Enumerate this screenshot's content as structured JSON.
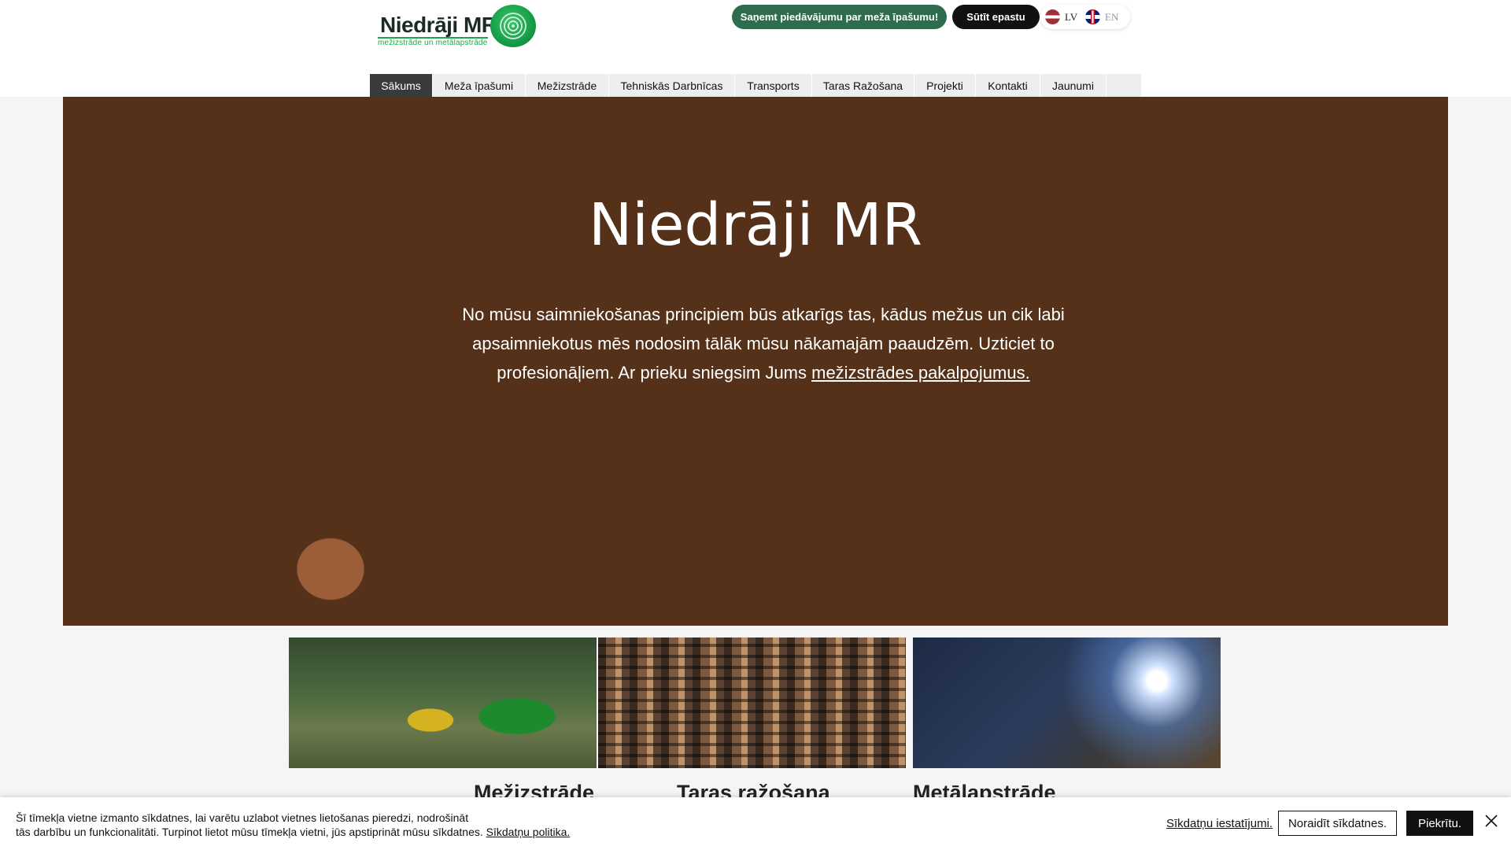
{
  "brand": {
    "name": "Niedrāji MR",
    "tagline": "mežizstrāde un metālapstrāde"
  },
  "header": {
    "offer_button": "Saņemt piedāvājumu par meža īpašumu!",
    "email_button": "Sūtīt epastu",
    "languages": [
      {
        "code": "LV",
        "active": true
      },
      {
        "code": "EN",
        "active": false
      }
    ]
  },
  "nav": {
    "items": [
      {
        "label": "Sākums",
        "active": true
      },
      {
        "label": "Meža īpašumi"
      },
      {
        "label": "Mežizstrāde"
      },
      {
        "label": "Tehniskās Darbnīcas"
      },
      {
        "label": "Transports"
      },
      {
        "label": "Taras Ražošana"
      },
      {
        "label": "Projekti"
      },
      {
        "label": "Kontakti"
      },
      {
        "label": "Jaunumi"
      }
    ]
  },
  "hero": {
    "title": "Niedrāji MR",
    "text_before_link": "No mūsu saimniekošanas principiem būs atkarīgs tas, kādus mežus un cik labi apsaimniekotus mēs nodosim tālāk mūsu nākamajām paaudzēm. Uzticiet to profesionāļiem. Ar prieku sniegsim Jums ",
    "link_text": "mežizstrādes pakalpojumus.",
    "text_after_link": ""
  },
  "services": [
    {
      "title": "Mežizstrāde",
      "image": "forest-harvester-image"
    },
    {
      "title": "Taras ražošana",
      "image": "stacked-lumber-image"
    },
    {
      "title": "Metālapstrāde",
      "image": "welder-image"
    }
  ],
  "cookie_banner": {
    "text_line1": "Šī tīmekļa vietne izmanto sīkdatnes, lai varētu uzlabot vietnes lietošanas pieredzi, nodrošināt",
    "text_line2": "tās darbību un funkcionalitāti. Turpinot lietot mūsu tīmekļa vietni, jūs apstiprināt mūsu sīkdatnes.",
    "policy_link": "Sīkdatņu politika.",
    "settings_link": "Sīkdatņu iestatījumi.",
    "reject_button": "Noraidīt sīkdatnes.",
    "accept_button": "Piekrītu."
  },
  "colors": {
    "offer_button": "#2f6b4d",
    "email_button": "#111111",
    "nav_active": "#3a3a3a",
    "logo_green": "#1fa64a"
  }
}
